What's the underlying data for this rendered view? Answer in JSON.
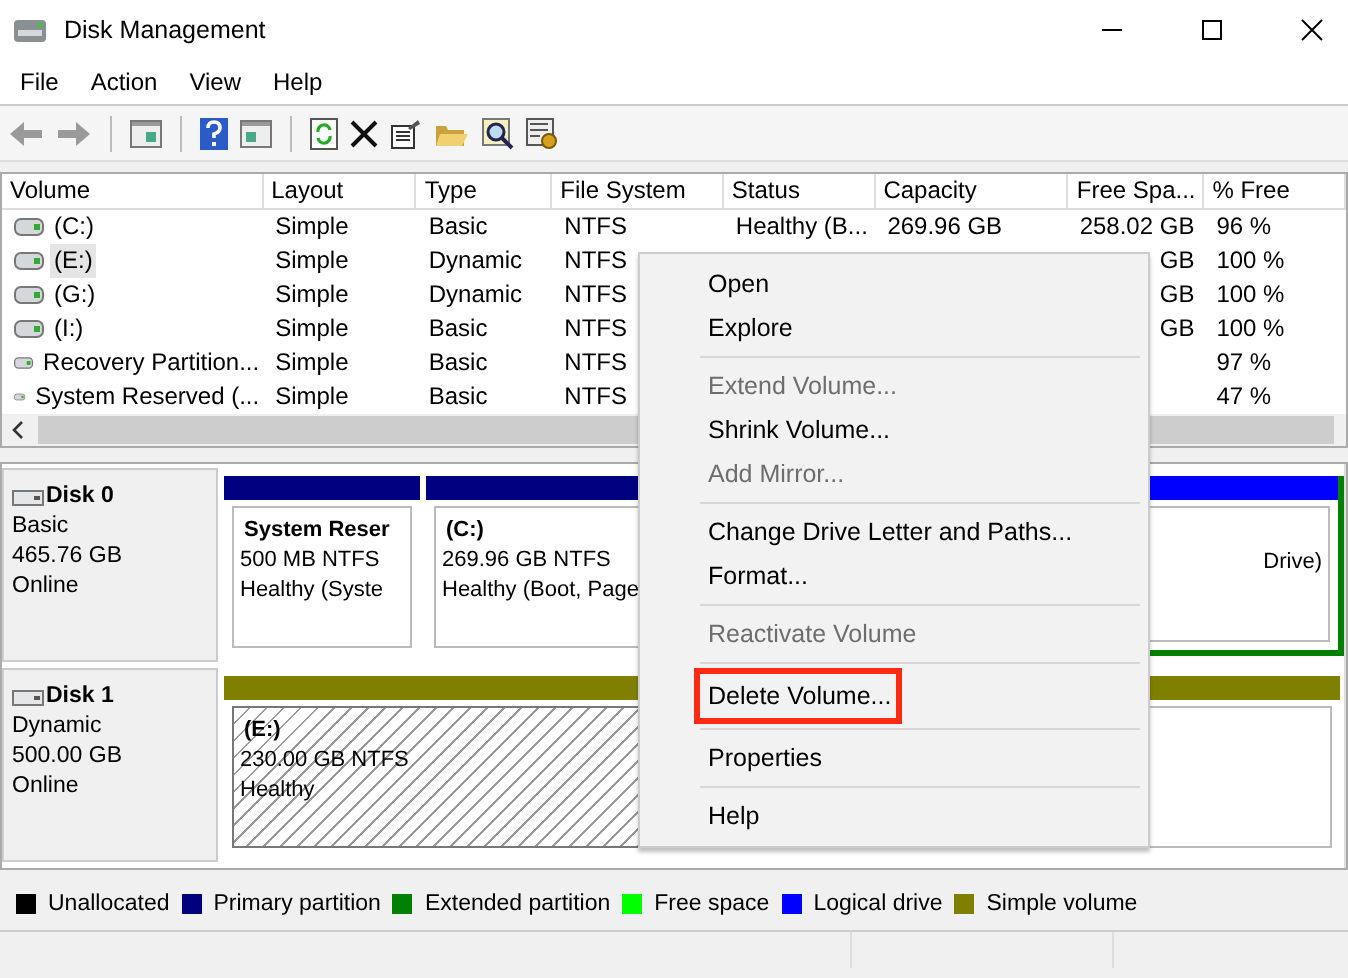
{
  "window": {
    "title": "Disk Management"
  },
  "menu_bar": [
    "File",
    "Action",
    "View",
    "Help"
  ],
  "table": {
    "columns": [
      "Volume",
      "Layout",
      "Type",
      "File System",
      "Status",
      "Capacity",
      "Free Spa...",
      "% Free"
    ],
    "rows": [
      {
        "volume": "(C:)",
        "layout": "Simple",
        "type": "Basic",
        "file_system": "NTFS",
        "status": "Healthy (B...",
        "capacity": "269.96 GB",
        "free_space": "258.02 GB",
        "percent_free": "96 %",
        "selected": false
      },
      {
        "volume": "(E:)",
        "layout": "Simple",
        "type": "Dynamic",
        "file_system": "NTFS",
        "free_space": "GB",
        "percent_free": "100 %",
        "selected": true
      },
      {
        "volume": "(G:)",
        "layout": "Simple",
        "type": "Dynamic",
        "file_system": "NTFS",
        "free_space": "GB",
        "percent_free": "100 %",
        "selected": false
      },
      {
        "volume": "(I:)",
        "layout": "Simple",
        "type": "Basic",
        "file_system": "NTFS",
        "free_space": "GB",
        "percent_free": "100 %",
        "selected": false
      },
      {
        "volume": "Recovery Partition...",
        "layout": "Simple",
        "type": "Basic",
        "file_system": "NTFS",
        "percent_free": "97 %",
        "selected": false
      },
      {
        "volume": "System Reserved (...",
        "layout": "Simple",
        "type": "Basic",
        "file_system": "NTFS",
        "percent_free": "47 %",
        "selected": false
      }
    ]
  },
  "disks": [
    {
      "name": "Disk 0",
      "type": "Basic",
      "size": "465.76 GB",
      "status": "Online",
      "partitions": [
        {
          "kind": "primary",
          "name": "System Reser",
          "lines": [
            "500 MB NTFS",
            "Healthy (Syste"
          ],
          "selected": false
        },
        {
          "kind": "primary",
          "name": "(C:)",
          "lines": [
            "269.96 GB NTFS",
            "Healthy (Boot, Page"
          ],
          "selected": false
        },
        {
          "kind": "logical",
          "lines": [
            "Drive)"
          ],
          "selected": false
        }
      ]
    },
    {
      "name": "Disk 1",
      "type": "Dynamic",
      "size": "500.00 GB",
      "status": "Online",
      "partitions": [
        {
          "kind": "simple",
          "name": "(E:)",
          "lines": [
            "230.00 GB NTFS",
            "Healthy"
          ],
          "selected": true
        },
        {
          "kind": "simple",
          "selected": false
        }
      ]
    }
  ],
  "legend": [
    {
      "label": "Unallocated",
      "color": "#000000"
    },
    {
      "label": "Primary partition",
      "color": "#000080"
    },
    {
      "label": "Extended partition",
      "color": "#008000"
    },
    {
      "label": "Free space",
      "color": "#00ff00"
    },
    {
      "label": "Logical drive",
      "color": "#0000ff"
    },
    {
      "label": "Simple volume",
      "color": "#808000"
    }
  ],
  "context_menu": {
    "items": [
      {
        "kind": "item",
        "label": "Open",
        "disabled": false,
        "highlighted": false
      },
      {
        "kind": "item",
        "label": "Explore",
        "disabled": false,
        "highlighted": false
      },
      {
        "kind": "separator"
      },
      {
        "kind": "item",
        "label": "Extend Volume...",
        "disabled": true,
        "highlighted": false
      },
      {
        "kind": "item",
        "label": "Shrink Volume...",
        "disabled": false,
        "highlighted": false
      },
      {
        "kind": "item",
        "label": "Add Mirror...",
        "disabled": true,
        "highlighted": false
      },
      {
        "kind": "separator"
      },
      {
        "kind": "item",
        "label": "Change Drive Letter and Paths...",
        "disabled": false,
        "highlighted": false
      },
      {
        "kind": "item",
        "label": "Format...",
        "disabled": false,
        "highlighted": false
      },
      {
        "kind": "separator"
      },
      {
        "kind": "item",
        "label": "Reactivate Volume",
        "disabled": true,
        "highlighted": false
      },
      {
        "kind": "separator"
      },
      {
        "kind": "item",
        "label": "Delete Volume...",
        "disabled": false,
        "highlighted": true
      },
      {
        "kind": "separator"
      },
      {
        "kind": "item",
        "label": "Properties",
        "disabled": false,
        "highlighted": false
      },
      {
        "kind": "separator"
      },
      {
        "kind": "item",
        "label": "Help",
        "disabled": false,
        "highlighted": false
      }
    ]
  }
}
